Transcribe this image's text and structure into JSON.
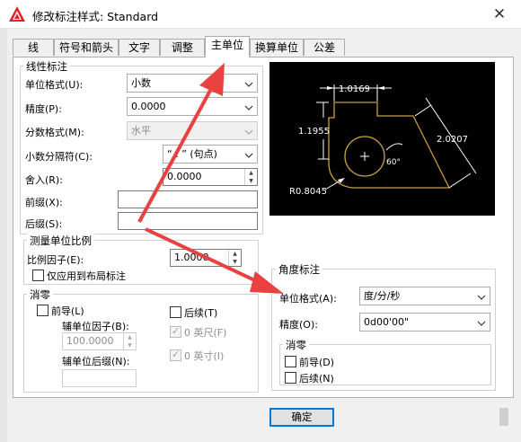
{
  "window": {
    "title": "修改标注样式: Standard",
    "close_glyph": "✕"
  },
  "tabs": [
    {
      "label": "线",
      "active": false
    },
    {
      "label": "符号和箭头",
      "active": false
    },
    {
      "label": "文字",
      "active": false
    },
    {
      "label": "调整",
      "active": false
    },
    {
      "label": "主单位",
      "active": true
    },
    {
      "label": "换算单位",
      "active": false
    },
    {
      "label": "公差",
      "active": false
    }
  ],
  "linear": {
    "group_label": "线性标注",
    "unit_format_label": "单位格式(U):",
    "unit_format_value": "小数",
    "precision_label": "精度(P):",
    "precision_value": "0.0000",
    "fraction_format_label": "分数格式(M):",
    "fraction_format_value": "水平",
    "decimal_sep_label": "小数分隔符(C):",
    "decimal_sep_value": "“ . ” (句点)",
    "roundoff_label": "舍入(R):",
    "roundoff_value": "0.0000",
    "prefix_label": "前缀(X):",
    "prefix_value": "",
    "suffix_label": "后缀(S):",
    "suffix_value": ""
  },
  "scale": {
    "group_label": "测量单位比例",
    "factor_label": "比例因子(E):",
    "factor_value": "1.0000",
    "layout_only_label": "仅应用到布局标注"
  },
  "zero_linear": {
    "group_label": "消零",
    "leading_label": "前导(L)",
    "trailing_label": "后续(T)",
    "sub_factor_label": "辅单位因子(B):",
    "sub_factor_value": "100.0000",
    "sub_suffix_label": "辅单位后缀(N):",
    "sub_suffix_value": "",
    "feet_label": "0 英尺(F)",
    "inches_label": "0 英寸(I)"
  },
  "preview": {
    "dim_top": "1.0169",
    "dim_left": "1.1955",
    "dim_right": "2.0207",
    "dim_angle": "60°",
    "dim_radius": "R0.8045"
  },
  "angular": {
    "group_label": "角度标注",
    "unit_format_label": "单位格式(A):",
    "unit_format_value": "度/分/秒",
    "precision_label": "精度(O):",
    "precision_value": "0d00'00\"",
    "zero_group_label": "消零",
    "leading_label": "前导(D)",
    "trailing_label": "后续(N)"
  },
  "buttons": {
    "ok_label": "确定"
  },
  "colors": {
    "accent": "#0078d7",
    "arrow_red": "#e8413f",
    "preview_bg": "#000000",
    "preview_outline": "#c8a040"
  }
}
